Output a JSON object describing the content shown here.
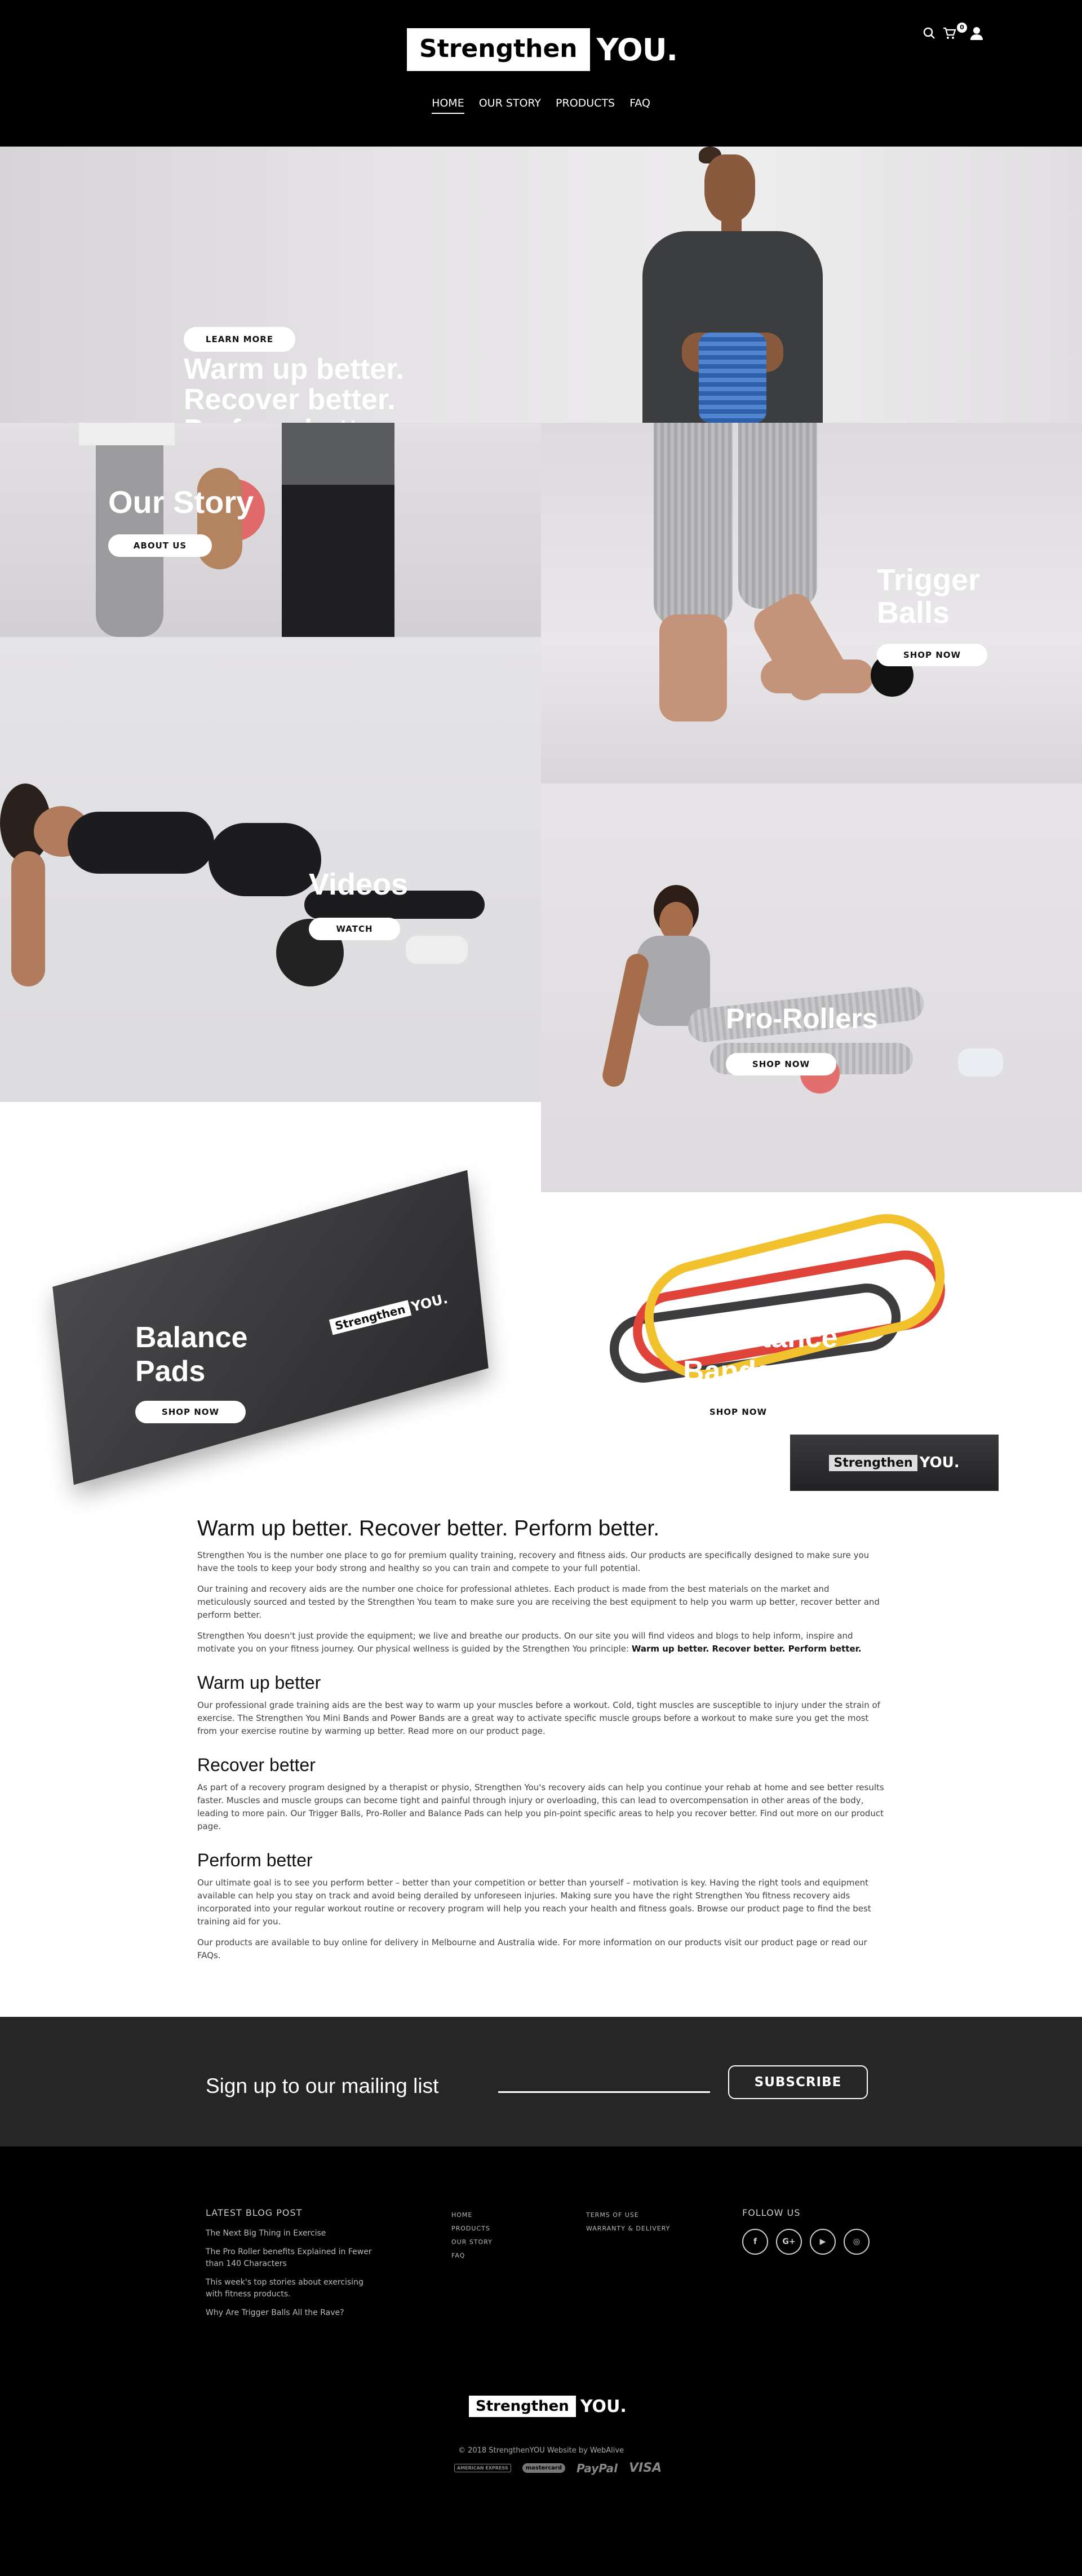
{
  "header": {
    "logo_box": "Strengthen",
    "logo_you": "YOU.",
    "cart_count": "0",
    "nav": [
      "HOME",
      "OUR STORY",
      "PRODUCTS",
      "FAQ"
    ],
    "icons": [
      "search-icon",
      "cart-icon",
      "user-icon"
    ]
  },
  "hero": {
    "line1": "Warm up better.",
    "line2": "Recover better.",
    "line3": "Perform better.",
    "button": "LEARN MORE"
  },
  "panels": {
    "story": {
      "title": "Our Story",
      "button": "ABOUT US"
    },
    "trigger": {
      "title_line1": "Trigger",
      "title_line2": "Balls",
      "button": "SHOP NOW"
    },
    "videos": {
      "title": "Videos",
      "button": "WATCH"
    },
    "rollers": {
      "title": "Pro-Rollers",
      "button": "SHOP NOW"
    }
  },
  "products": {
    "balance": {
      "title_line1": "Balance",
      "title_line2": "Pads",
      "button": "SHOP NOW",
      "brand_box": "Strengthen",
      "brand_you": "YOU."
    },
    "bands": {
      "title_line1": "Resistance",
      "title_line2": "Bands",
      "button": "SHOP NOW",
      "brand_box": "Strengthen",
      "brand_you": "YOU."
    }
  },
  "content": {
    "h1": "Warm up better. Recover better. Perform better.",
    "p1": "Strengthen You is the number one place to go for premium quality training, recovery and fitness aids. Our products are specifically designed to make sure you have the tools to keep your body strong and healthy so you can train and compete to your full potential.",
    "p2": "Our training and recovery aids are the number one choice for professional athletes. Each product is made from the best materials on the market and meticulously sourced and tested by the Strengthen You team to make sure you are receiving the best equipment to help you warm up better, recover better and perform better.",
    "p3": "Strengthen You doesn't just provide the equipment; we live and breathe our products. On our site you will find videos and blogs to help inform, inspire and motivate you on your fitness journey. Our physical wellness is guided by the Strengthen You principle:",
    "p3_bold": "Warm up better. Recover better. Perform better.",
    "h2_warm": "Warm up better",
    "p_warm": "Our professional grade training aids are the best way to warm up your muscles before a workout. Cold, tight muscles are susceptible to injury under the strain of exercise. The Strengthen You Mini Bands and Power Bands are a great way to activate specific muscle groups before a workout to make sure you get the most from your exercise routine by warming up better. Read more on our product page.",
    "h2_recover": "Recover better",
    "p_recover": "As part of a recovery program designed by a therapist or physio, Strengthen You's recovery aids can help you continue your rehab at home and see better results faster. Muscles and muscle groups can become tight and painful through injury or overloading, this can lead to overcompensation in other areas of the body, leading to more pain. Our Trigger Balls, Pro-Roller and Balance Pads can help you pin-point specific areas to help you recover better. Find out more on our product page.",
    "h2_perform": "Perform better",
    "p_perform": "Our ultimate goal is to see you perform better – better than your competition or better than yourself – motivation is key. Having the right tools and equipment available can help you stay on track and avoid being derailed by unforeseen injuries. Making sure you have the right Strengthen You fitness recovery aids incorporated into your regular workout routine or recovery program will help you reach your health and fitness goals. Browse our product page to find the best training aid for you.",
    "p_final": "Our products are available to buy online for delivery in Melbourne and Australia wide. For more information on our products visit our product page or read our FAQs."
  },
  "mailing": {
    "title": "Sign up to our mailing list",
    "button": "SUBSCRIBE"
  },
  "footer": {
    "blog_heading": "LATEST BLOG POST",
    "blog_posts": [
      "The Next Big Thing in Exercise",
      "The Pro Roller benefits Explained in Fewer than 140 Characters",
      "This week's top stories about exercising with fitness products.",
      "Why Are Trigger Balls All the Rave?"
    ],
    "nav_links": [
      "HOME",
      "PRODUCTS",
      "OUR STORY",
      "FAQ"
    ],
    "legal_links": [
      "TERMS OF USE",
      "WARRANTY & DELIVERY"
    ],
    "follow_heading": "FOLLOW US",
    "social": [
      "f",
      "G+",
      "▶",
      "◎"
    ],
    "social_icons": [
      "facebook-icon",
      "google-plus-icon",
      "youtube-icon",
      "instagram-icon"
    ],
    "logo_box": "Strengthen",
    "logo_you": "YOU.",
    "copyright": "© 2018 StrengthenYOU Website by WebAlive",
    "payments": [
      "AMERICAN EXPRESS",
      "mastercard",
      "PayPal",
      "VISA"
    ]
  }
}
